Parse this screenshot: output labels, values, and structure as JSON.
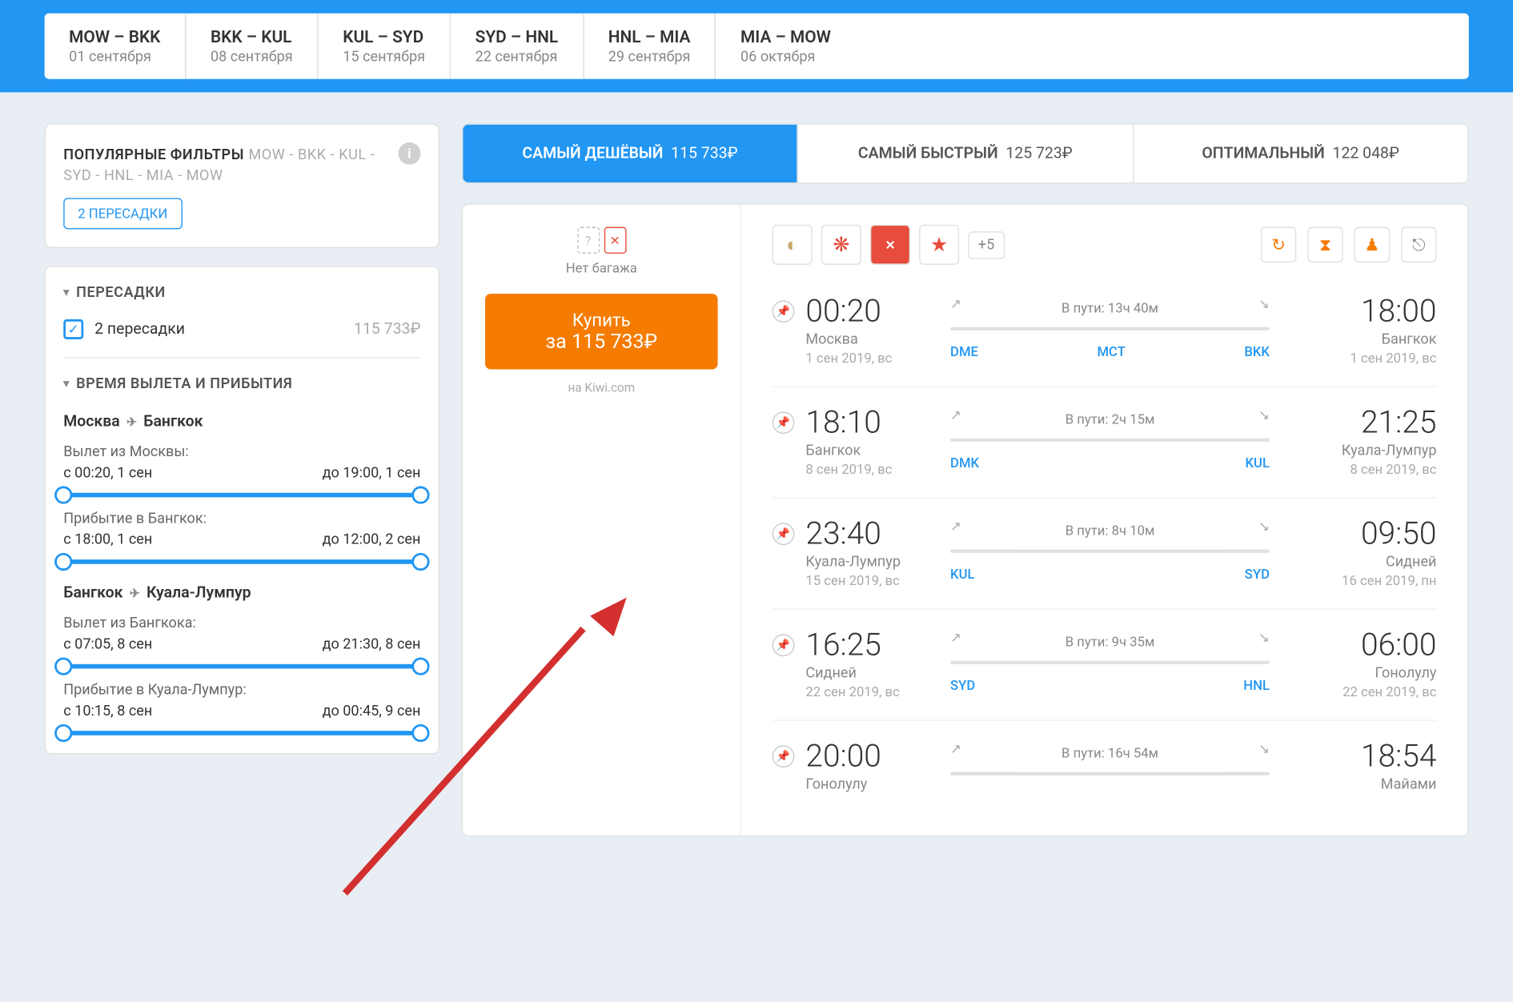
{
  "routes": [
    {
      "code": "MOW – BKK",
      "date": "01 сентября"
    },
    {
      "code": "BKK – KUL",
      "date": "08 сентября"
    },
    {
      "code": "KUL – SYD",
      "date": "15 сентября"
    },
    {
      "code": "SYD – HNL",
      "date": "22 сентября"
    },
    {
      "code": "HNL – MIA",
      "date": "29 сентября"
    },
    {
      "code": "MIA – MOW",
      "date": "06 октября"
    }
  ],
  "filters": {
    "popular_title": "ПОПУЛЯРНЫЕ ФИЛЬТРЫ",
    "popular_sub": "MOW - BKK - KUL - SYD - HNL - MIA - MOW",
    "chip": "2 ПЕРЕСАДКИ",
    "transfers_title": "ПЕРЕСАДКИ",
    "two_transfers": "2 пересадки",
    "two_transfers_price": "115 733₽",
    "time_title": "ВРЕМЯ ВЫЛЕТА И ПРИБЫТИЯ",
    "route1": {
      "from": "Москва",
      "to": "Бангкок",
      "dep_label": "Вылет из Москвы:",
      "dep_from": "с 00:20, 1 сен",
      "dep_to": "до 19:00, 1 сен",
      "arr_label": "Прибытие в Бангкок:",
      "arr_from": "с 18:00, 1 сен",
      "arr_to": "до 12:00, 2 сен"
    },
    "route2": {
      "from": "Бангкок",
      "to": "Куала-Лумпур",
      "dep_label": "Вылет из Бангкока:",
      "dep_from": "с 07:05, 8 сен",
      "dep_to": "до 21:30, 8 сен",
      "arr_label": "Прибытие в Куала-Лумпур:",
      "arr_from": "с 10:15, 8 сен",
      "arr_to": "до 00:45, 9 сен"
    }
  },
  "tabs": [
    {
      "label": "САМЫЙ ДЕШЁВЫЙ",
      "price": "115 733₽"
    },
    {
      "label": "САМЫЙ БЫСТРЫЙ",
      "price": "125 723₽"
    },
    {
      "label": "ОПТИМАЛЬНЫЙ",
      "price": "122 048₽"
    }
  ],
  "buy": {
    "no_baggage": "Нет багажа",
    "btn_label": "Купить",
    "btn_price": "за 115 733₽",
    "provider": "на Kiwi.com",
    "plus_airlines": "+5"
  },
  "segments": [
    {
      "dep_time": "00:20",
      "dep_city": "Москва",
      "dep_date": "1 сен 2019, вс",
      "duration": "В пути: 13ч 40м",
      "code_from": "DME",
      "code_mid": "MCT",
      "code_to": "BKK",
      "arr_time": "18:00",
      "arr_city": "Бангкок",
      "arr_date": "1 сен 2019, вс"
    },
    {
      "dep_time": "18:10",
      "dep_city": "Бангкок",
      "dep_date": "8 сен 2019, вс",
      "duration": "В пути: 2ч 15м",
      "code_from": "DMK",
      "code_mid": "",
      "code_to": "KUL",
      "arr_time": "21:25",
      "arr_city": "Куала-Лумпур",
      "arr_date": "8 сен 2019, вс"
    },
    {
      "dep_time": "23:40",
      "dep_city": "Куала-Лумпур",
      "dep_date": "15 сен 2019, вс",
      "duration": "В пути: 8ч 10м",
      "code_from": "KUL",
      "code_mid": "",
      "code_to": "SYD",
      "arr_time": "09:50",
      "arr_city": "Сидней",
      "arr_date": "16 сен 2019, пн"
    },
    {
      "dep_time": "16:25",
      "dep_city": "Сидней",
      "dep_date": "22 сен 2019, вс",
      "duration": "В пути: 9ч 35м",
      "code_from": "SYD",
      "code_mid": "",
      "code_to": "HNL",
      "arr_time": "06:00",
      "arr_city": "Гонолулу",
      "arr_date": "22 сен 2019, вс"
    },
    {
      "dep_time": "20:00",
      "dep_city": "Гонолулу",
      "dep_date": "",
      "duration": "В пути: 16ч 54м",
      "code_from": "",
      "code_mid": "",
      "code_to": "",
      "arr_time": "18:54",
      "arr_city": "Майами",
      "arr_date": ""
    }
  ]
}
